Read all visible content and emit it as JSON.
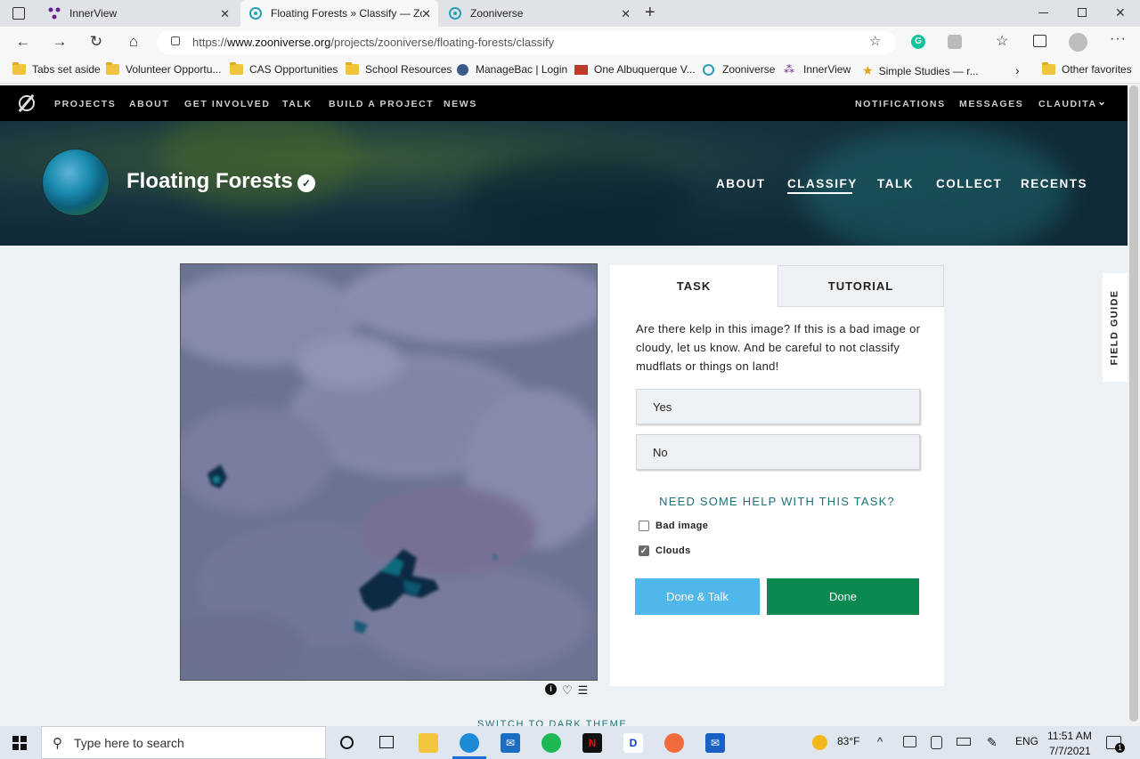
{
  "browser": {
    "tabs": [
      {
        "label": "InnerView",
        "active": false
      },
      {
        "label": "Floating Forests » Classify — Zoo",
        "active": true
      },
      {
        "label": "Zooniverse",
        "active": false
      }
    ],
    "new_tab": "+",
    "url_prefix": "https://",
    "url_host": "www.zooniverse.org",
    "url_path": "/projects/zooniverse/floating-forests/classify",
    "favorites": [
      {
        "label": "Tabs set aside",
        "icon": "folder-icon"
      },
      {
        "label": "Volunteer Opportu...",
        "icon": "folder-icon"
      },
      {
        "label": "CAS Opportunities",
        "icon": "folder-icon"
      },
      {
        "label": "School Resources",
        "icon": "folder-icon"
      },
      {
        "label": "ManageBac | Login",
        "icon": "globe-icon"
      },
      {
        "label": "One Albuquerque V...",
        "icon": "site-icon"
      },
      {
        "label": "Zooniverse",
        "icon": "zooniverse-icon"
      },
      {
        "label": "InnerView",
        "icon": "innerview-icon"
      },
      {
        "label": "Simple Studies — r...",
        "icon": "star-icon"
      }
    ],
    "other_favorites": "Other favorites"
  },
  "zoonav": {
    "left": [
      "PROJECTS",
      "ABOUT",
      "GET INVOLVED",
      "TALK",
      "BUILD A PROJECT",
      "NEWS"
    ],
    "right": [
      "NOTIFICATIONS",
      "MESSAGES",
      "CLAUDITA"
    ]
  },
  "project": {
    "title": "Floating Forests",
    "nav": [
      "ABOUT",
      "CLASSIFY",
      "TALK",
      "COLLECT",
      "RECENTS"
    ],
    "active_nav": "CLASSIFY"
  },
  "task_panel": {
    "tabs": [
      "TASK",
      "TUTORIAL"
    ],
    "question": "Are there kelp in this image? If this is a bad image or cloudy, let us know. And be careful to not classify mudflats or things on land!",
    "answers": [
      "Yes",
      "No"
    ],
    "help_link": "NEED SOME HELP WITH THIS TASK?",
    "checkboxes": [
      {
        "label": "Bad image",
        "checked": false
      },
      {
        "label": "Clouds",
        "checked": true
      }
    ],
    "done_talk": "Done & Talk",
    "done": "Done"
  },
  "field_guide": "FIELD GUIDE",
  "dark_theme": "SWITCH TO DARK THEME",
  "taskbar": {
    "search_placeholder": "Type here to search",
    "weather": "83°F",
    "lang": "ENG",
    "time": "11:51 AM",
    "date": "7/7/2021",
    "notifications": "1"
  },
  "colors": {
    "zoonav_bg": "#000000",
    "teal_link": "#1f6f79",
    "done_green": "#0b8a50",
    "done_talk_blue": "#4fb7ea"
  }
}
